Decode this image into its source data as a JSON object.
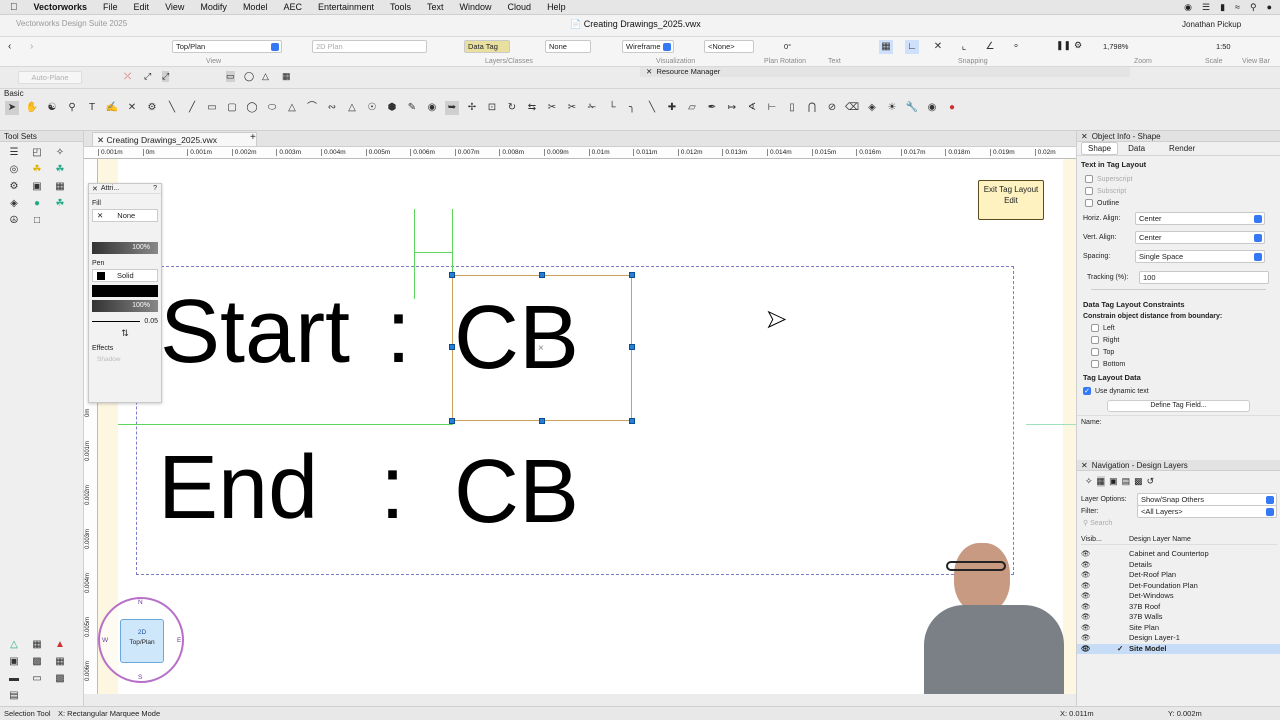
{
  "menubar": {
    "app": "Vectorworks",
    "items": [
      "File",
      "Edit",
      "View",
      "Modify",
      "Model",
      "AEC",
      "Entertainment",
      "Tools",
      "Text",
      "Window",
      "Cloud",
      "Help"
    ]
  },
  "titlebar": {
    "app_title": "Vectorworks Design Suite 2025",
    "doc_title": "Creating Drawings_2025.vwx",
    "user": "Jonathan Pickup"
  },
  "viewbar": {
    "view": "Top/Plan",
    "plane": "2D Plan",
    "class": "Data Tag",
    "layer": "None",
    "render": "Wireframe",
    "layer_label": "<None>",
    "rotation": "0°",
    "zoom": "1,798%",
    "scale": "1:50",
    "groups": {
      "view": "View",
      "layers_classes": "Layers/Classes",
      "visualization": "Visualization",
      "plan_rotation": "Plan Rotation",
      "text": "Text",
      "snapping": "Snapping",
      "zoom": "Zoom",
      "scale": "Scale",
      "view_bar": "View Bar"
    }
  },
  "modebar": {
    "auto_plane": "Auto-Plane",
    "resource_manager": "Resource Manager"
  },
  "toolsets": {
    "title": "Tool Sets",
    "basic": "Basic"
  },
  "document": {
    "tab": "Creating Drawings_2025.vwx",
    "ruler_ticks": [
      "0.001m",
      "0m",
      "0.001m",
      "0.002m",
      "0.003m",
      "0.004m",
      "0.005m",
      "0.006m",
      "0.007m",
      "0.008m",
      "0.009m",
      "0.01m",
      "0.011m",
      "0.012m",
      "0.013m",
      "0.014m",
      "0.015m",
      "0.016m",
      "0.017m",
      "0.018m",
      "0.019m",
      "0.02m"
    ],
    "vruler_ticks": [
      "0m",
      "0.001m",
      "0.002m",
      "0.003m",
      "0.004m",
      "0.005m",
      "0.006m"
    ],
    "line1_label": "Start",
    "line1_value": "CB",
    "line2_label": "End",
    "line2_value": "CB",
    "colon": ":",
    "exit_button": "Exit Tag Layout Edit",
    "view_cube": {
      "mode": "2D",
      "view": "Top/Plan",
      "n": "N",
      "s": "S",
      "e": "E",
      "w": "W"
    }
  },
  "attributes": {
    "title": "Attri...",
    "fill_label": "Fill",
    "fill_value": "None",
    "fill_opacity": "100%",
    "pen_label": "Pen",
    "pen_value": "Solid",
    "pen_opacity": "100%",
    "line_weight": "0.05",
    "effects_label": "Effects",
    "shadow_label": "Shadow"
  },
  "object_info": {
    "title": "Object Info - Shape",
    "tabs": [
      "Shape",
      "Data",
      "Render"
    ],
    "section": "Text in Tag Layout",
    "superscript": "Superscript",
    "subscript": "Subscript",
    "outline": "Outline",
    "horiz_align_label": "Horiz. Align:",
    "horiz_align": "Center",
    "vert_align_label": "Vert. Align:",
    "vert_align": "Center",
    "spacing_label": "Spacing:",
    "spacing": "Single Space",
    "tracking_label": "Tracking (%):",
    "tracking": "100",
    "constraints_title": "Data Tag Layout Constraints",
    "constraints_sub": "Constrain object distance from boundary:",
    "constraints": [
      "Left",
      "Right",
      "Top",
      "Bottom"
    ],
    "layout_data": "Tag Layout Data",
    "use_dynamic": "Use dynamic text",
    "define_button": "Define Tag Field...",
    "name_label": "Name:"
  },
  "navigation": {
    "title": "Navigation - Design Layers",
    "layer_options_label": "Layer Options:",
    "layer_options": "Show/Snap Others",
    "filter_label": "Filter:",
    "filter": "<All Layers>",
    "search_placeholder": "Search",
    "col_visibility": "Visib...",
    "col_name": "Design Layer Name",
    "layers": [
      "Cabinet and Countertop",
      "Details",
      "Det-Roof Plan",
      "Det-Foundation Plan",
      "Det-Windows",
      "37B Roof",
      "37B Walls",
      "Site Plan",
      "Design Layer-1",
      "Site Model"
    ],
    "active_layer": "Site Model"
  },
  "status": {
    "tool": "Selection Tool",
    "mode": "X: Rectangular Marquee Mode",
    "x": "X: 0.011m",
    "y": "Y: 0.002m"
  },
  "colors": {
    "accent": "#3478f6",
    "tag_border": "#c9a15a",
    "canvas_bg": "#fdf6e0",
    "selection_handle": "#2a7fd4",
    "guide_green": "#55d655"
  }
}
